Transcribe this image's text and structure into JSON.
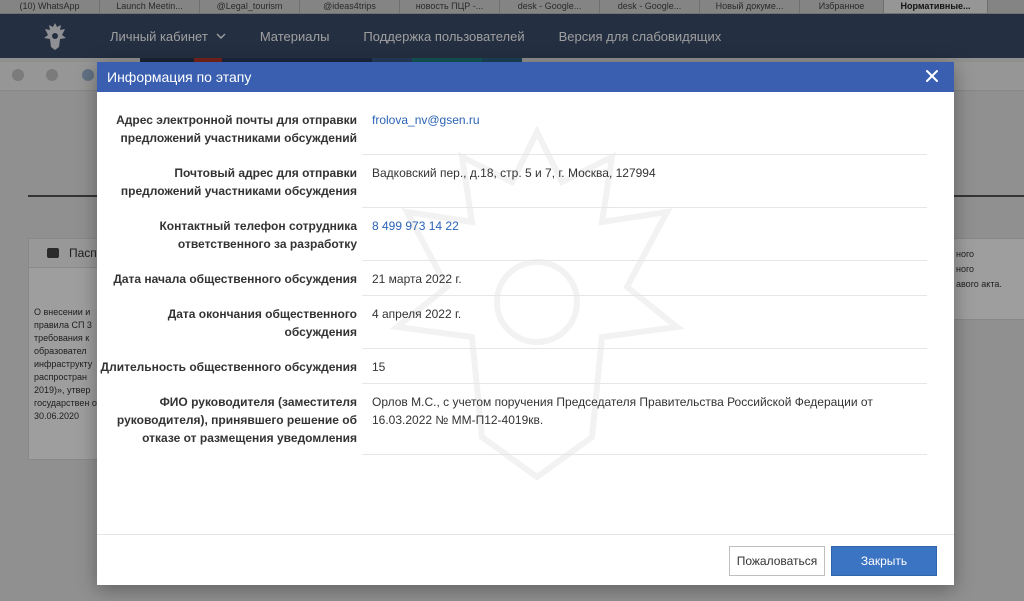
{
  "browser_tabs": [
    {
      "label": "(10) WhatsApp",
      "w": 100
    },
    {
      "label": "Launch Meetin...",
      "w": 100
    },
    {
      "label": "@Legal_tourism",
      "w": 100
    },
    {
      "label": "@ideas4trips",
      "w": 100
    },
    {
      "label": "новость ПЦР -...",
      "w": 100
    },
    {
      "label": "desk - Google...",
      "w": 100
    },
    {
      "label": "desk - Google...",
      "w": 100
    },
    {
      "label": "Новый докуме...",
      "w": 100
    },
    {
      "label": "Избранное",
      "w": 84
    },
    {
      "label": "Нормативные...",
      "w": 104
    }
  ],
  "header": {
    "nav": [
      "Личный кабинет",
      "Материалы",
      "Поддержка пользователей",
      "Версия для слабовидящих"
    ]
  },
  "background": {
    "card_left_title": "Паспо",
    "left_text": "О внесении и правила СП 3 требования к образовател инфраструкту распростран 2019)», утвер государствен от 30.06.2020",
    "right_text": [
      "ного",
      "ного",
      "авого акта."
    ]
  },
  "modal": {
    "title": "Информация по этапу",
    "rows": [
      {
        "label": "Адрес электронной почты для отправки предложений участниками обсуждений",
        "value": "frolova_nv@gsen.ru",
        "link": true
      },
      {
        "label": "Почтовый адрес для отправки предложений участниками обсуждения",
        "value": "Вадковский пер., д.18, стр. 5 и 7, г. Москва, 127994",
        "link": false
      },
      {
        "label": "Контактный телефон сотрудника ответственного за разработку",
        "value": "8 499 973 14 22",
        "link": true
      },
      {
        "label": "Дата начала общественного обсуждения",
        "value": "21 марта 2022 г.",
        "link": false
      },
      {
        "label": "Дата окончания общественного обсуждения",
        "value": "4 апреля 2022 г.",
        "link": false
      },
      {
        "label": "Длительность общественного обсуждения",
        "value": "15",
        "link": false
      },
      {
        "label": "ФИО руководителя (заместителя руководителя), принявшего решение об отказе от размещения уведомления",
        "value": "Орлов М.С., с учетом поручения Председателя Правительства Российской Федерации от 16.03.2022 № ММ-П12-4019кв.",
        "link": false
      }
    ],
    "buttons": {
      "complain": "Пожаловаться",
      "close": "Закрыть"
    }
  },
  "colors": {
    "header_bg": "#3b4d69",
    "modal_header_bg": "#3a5fb0",
    "link": "#2a63b5",
    "primary_button": "#3b74c2"
  }
}
